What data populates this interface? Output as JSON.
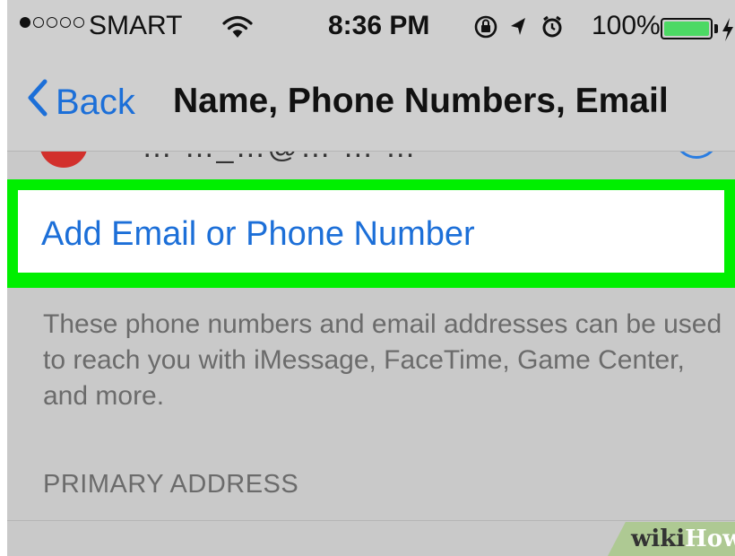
{
  "status_bar": {
    "carrier": "SMART",
    "time": "8:36 PM",
    "battery_percent": "100%",
    "signal_bars_filled": 1,
    "signal_bars_total": 5,
    "battery_color": "#4cd964"
  },
  "nav": {
    "back_label": "Back",
    "title": "Name, Phone Numbers, Email"
  },
  "partial_row": {
    "text": "… …_…@… … …"
  },
  "add_row": {
    "label": "Add Email or Phone Number",
    "highlight_color": "#00ef00"
  },
  "footer_note": "These phone numbers and email addresses can be used to reach you with iMessage, FaceTime, Game Center, and more.",
  "section_header": "PRIMARY ADDRESS",
  "bottom_row": {
    "text": "…"
  },
  "watermark": {
    "part1": "wiki",
    "part2": "How"
  },
  "colors": {
    "accent": "#1c6fd8",
    "background": "#c9c9c9"
  },
  "icons": [
    "wifi-icon",
    "rotation-lock-icon",
    "location-arrow-icon",
    "alarm-icon",
    "battery-icon",
    "charging-bolt-icon",
    "back-chevron-icon",
    "info-icon"
  ]
}
